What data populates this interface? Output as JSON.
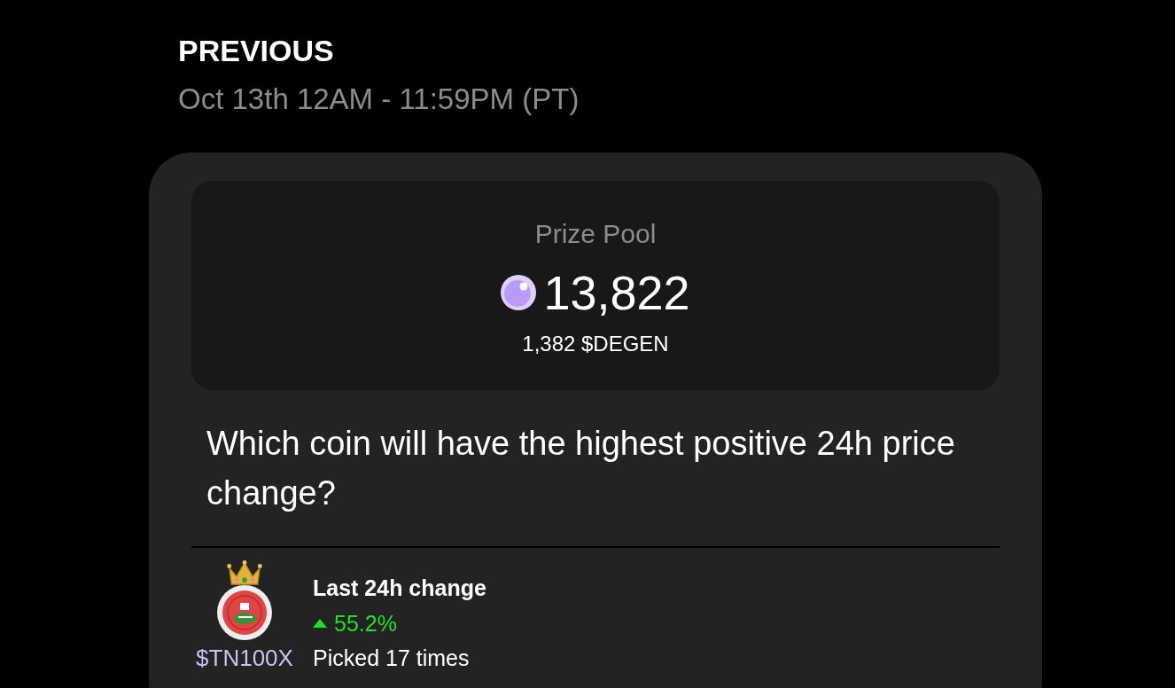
{
  "header": {
    "title": "PREVIOUS",
    "period": "Oct 13th 12AM - 11:59PM (PT)"
  },
  "prize_pool": {
    "label": "Prize Pool",
    "amount": "13,822",
    "degen_amount": "1,382 $DEGEN"
  },
  "question": "Which coin will have the highest positive 24h price change?",
  "options": [
    {
      "ticker": "$TN100X",
      "winner": true,
      "change_label": "Last 24h change",
      "rising": true,
      "change": "55.2%",
      "picks": "Picked 17 times"
    }
  ]
}
